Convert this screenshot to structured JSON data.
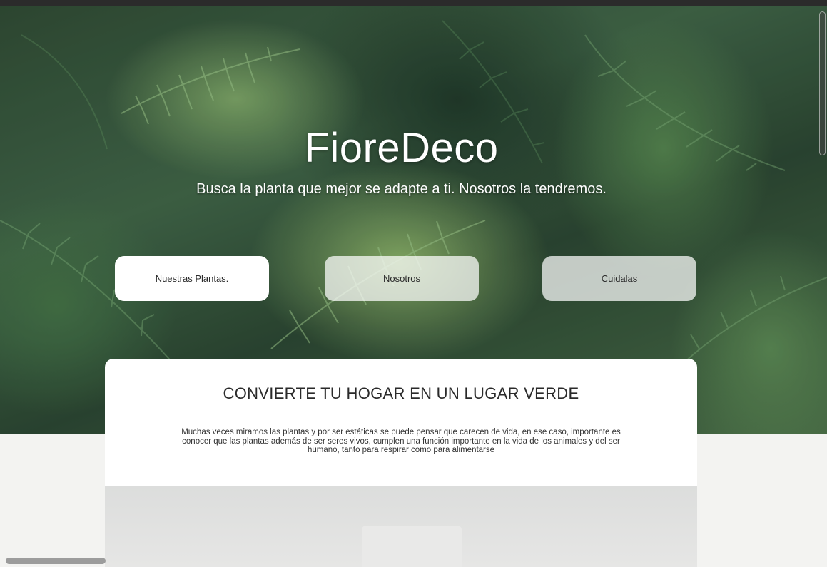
{
  "hero": {
    "title": "FioreDeco",
    "subtitle": "Busca la planta que mejor se adapte a ti. Nosotros la tendremos."
  },
  "nav": {
    "buttons": [
      {
        "label": "Nuestras Plantas."
      },
      {
        "label": "Nosotros"
      },
      {
        "label": "Cuidalas"
      }
    ]
  },
  "section": {
    "heading": "CONVIERTE TU HOGAR EN UN LUGAR VERDE",
    "body": "Muchas veces miramos las plantas y por ser estáticas se puede pensar que carecen de vida, en ese caso, importante es conocer que las plantas además de ser seres vivos, cumplen una función importante en la vida de los animales y del ser humano, tanto para respirar como para alimentarse"
  },
  "colors": {
    "hero_green": "#3f6346",
    "card_bg": "#ffffff",
    "page_bg": "#f3f3f1",
    "text_dark": "#2a2a2a"
  }
}
